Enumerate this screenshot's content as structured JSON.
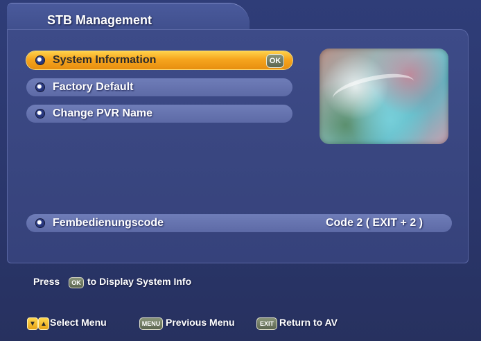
{
  "window": {
    "title": "STB Management"
  },
  "menu": {
    "items": [
      {
        "label": "System Information",
        "badge": "OK"
      },
      {
        "label": "Factory Default"
      },
      {
        "label": "Change PVR Name"
      }
    ],
    "setting": {
      "label": "Fembedienungscode",
      "value": "Code 2 ( EXIT + 2 )"
    }
  },
  "help": {
    "press": "Press",
    "ok": "OK",
    "text": "to Display System Info"
  },
  "legend": {
    "down_icon": "▼",
    "up_icon": "▲",
    "select": "Select Menu",
    "menu_key": "MENU",
    "previous": "Previous Menu",
    "exit_key": "EXIT",
    "return": "Return to AV"
  },
  "colors": {
    "background": "#2f3d78",
    "highlight": "#f6a51e",
    "menu_pill": "#6f7db8",
    "text": "#ffffff"
  }
}
